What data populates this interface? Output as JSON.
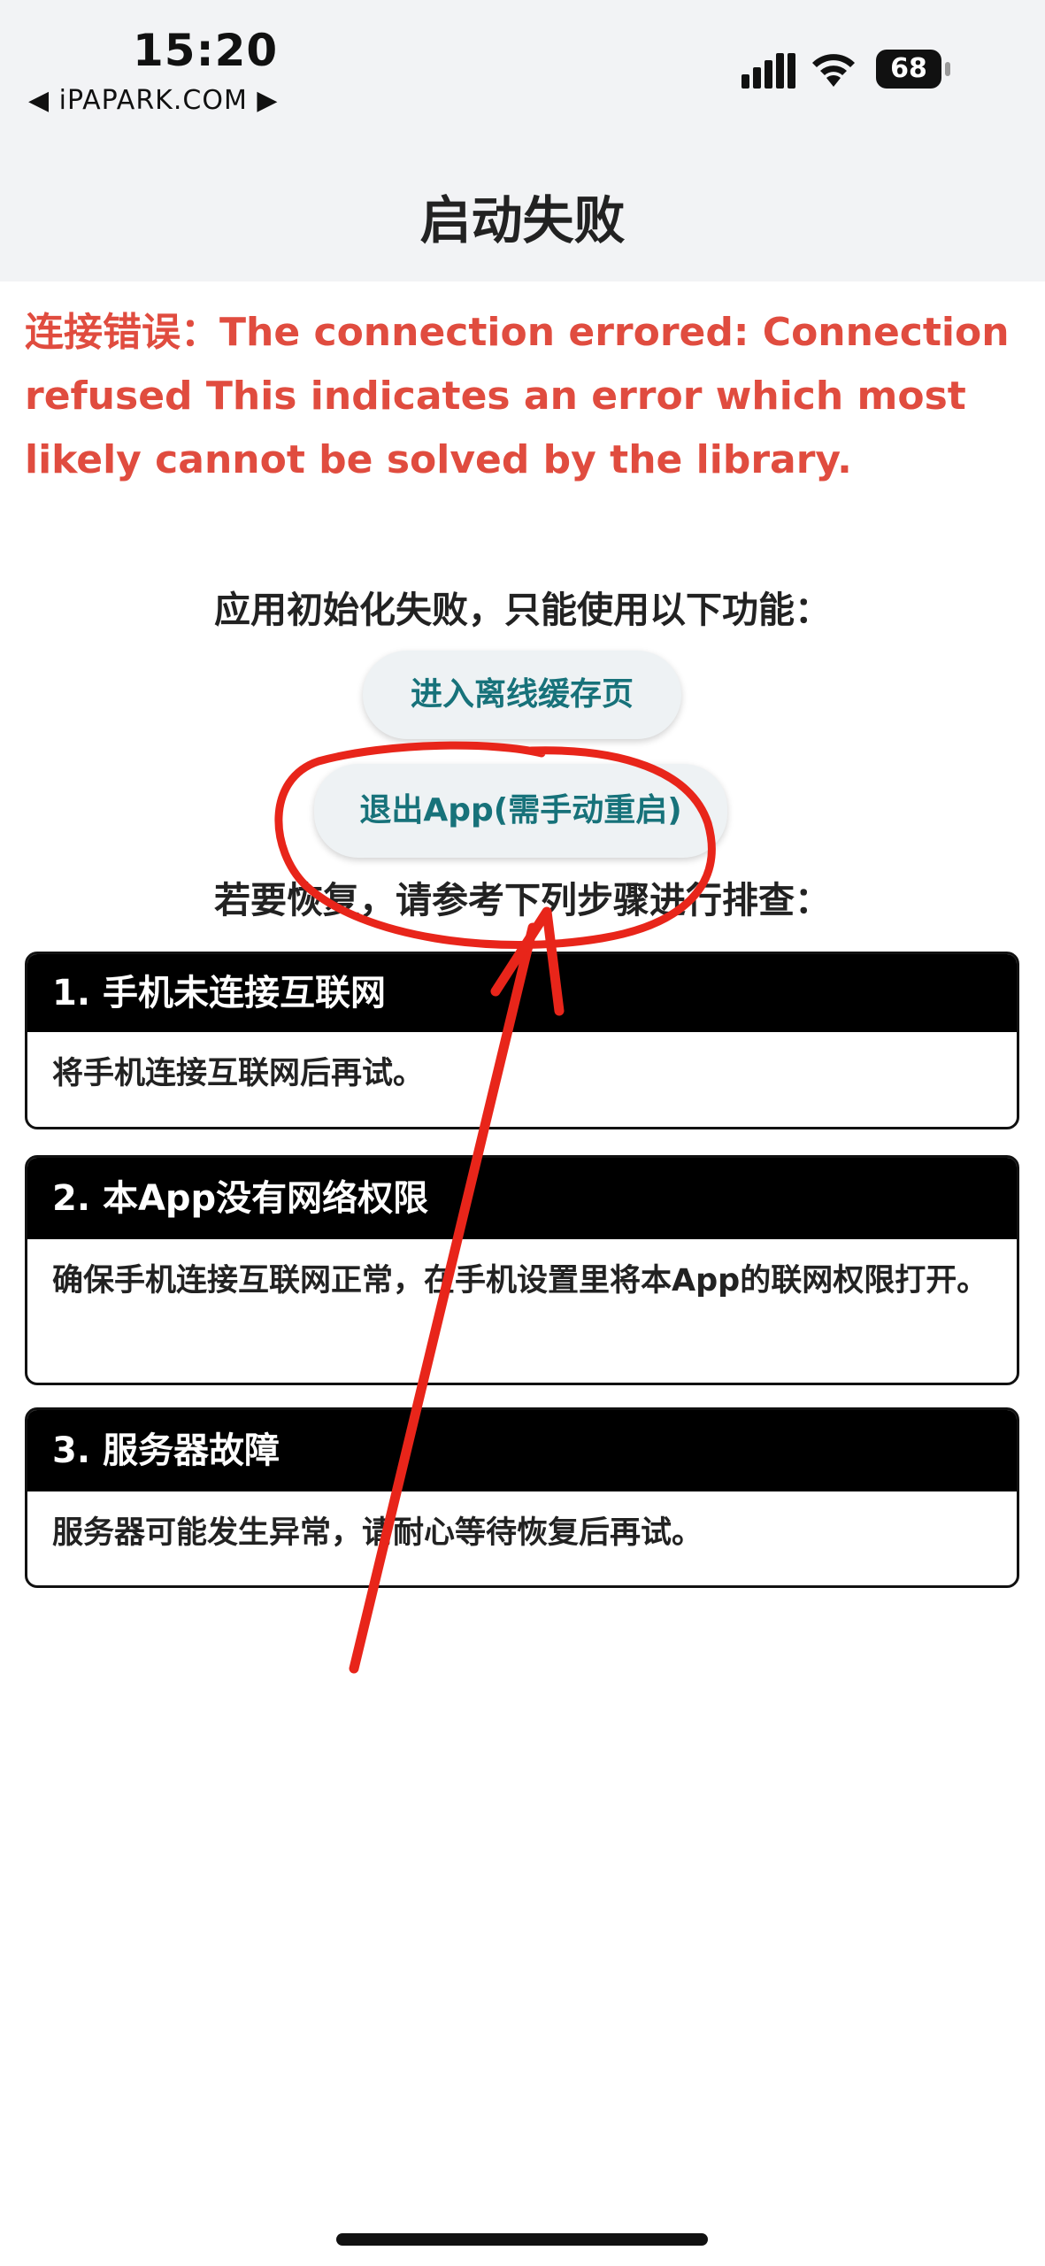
{
  "status_bar": {
    "time": "15:20",
    "back_label": "◀ iPAPARK.COM ▶",
    "battery_level": "68"
  },
  "nav": {
    "title": "启动失败"
  },
  "error": {
    "message": "连接错误：The connection errored: Connection refused This indicates an error which most likely cannot be solved by the library."
  },
  "init_failed_text": "应用初始化失败，只能使用以下功能：",
  "buttons": {
    "offline_cache": "进入离线缓存页",
    "exit_app": "退出App(需手动重启)"
  },
  "recover_text": "若要恢复，请参考下列步骤进行排查：",
  "cards": [
    {
      "title": "1. 手机未连接互联网",
      "body": "将手机连接互联网后再试。"
    },
    {
      "title": "2. 本App没有网络权限",
      "body": "确保手机连接互联网正常，在手机设置里将本App的联网权限打开。"
    },
    {
      "title": "3. 服务器故障",
      "body": "服务器可能发生异常，请耐心等待恢复后再试。"
    }
  ],
  "colors": {
    "error_red": "#e04c3f",
    "button_text_teal": "#17727a",
    "annotation_red": "#e8251a"
  }
}
